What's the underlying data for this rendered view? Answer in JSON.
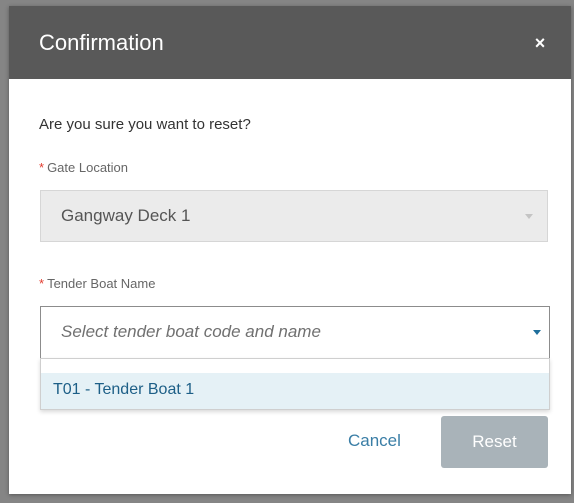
{
  "dialog": {
    "title": "Confirmation",
    "close_glyph": "×",
    "close_icon": "close-icon",
    "question": "Are you sure you want to reset?"
  },
  "gate_location": {
    "required_mark": "*",
    "label": "Gate Location",
    "value": "Gangway Deck 1",
    "disabled": true
  },
  "tender_boat": {
    "required_mark": "*",
    "label": "Tender Boat Name",
    "placeholder": "Select tender boat code and name",
    "options": [
      "T01 - Tender Boat 1"
    ]
  },
  "actions": {
    "cancel_label": "Cancel",
    "reset_label": "Reset"
  },
  "colors": {
    "header_bg": "#595959",
    "required": "#e23b2e",
    "link": "#3a7ea6",
    "reset_disabled_bg": "#a9b3b9",
    "option_highlight": "#e5f1f6"
  }
}
